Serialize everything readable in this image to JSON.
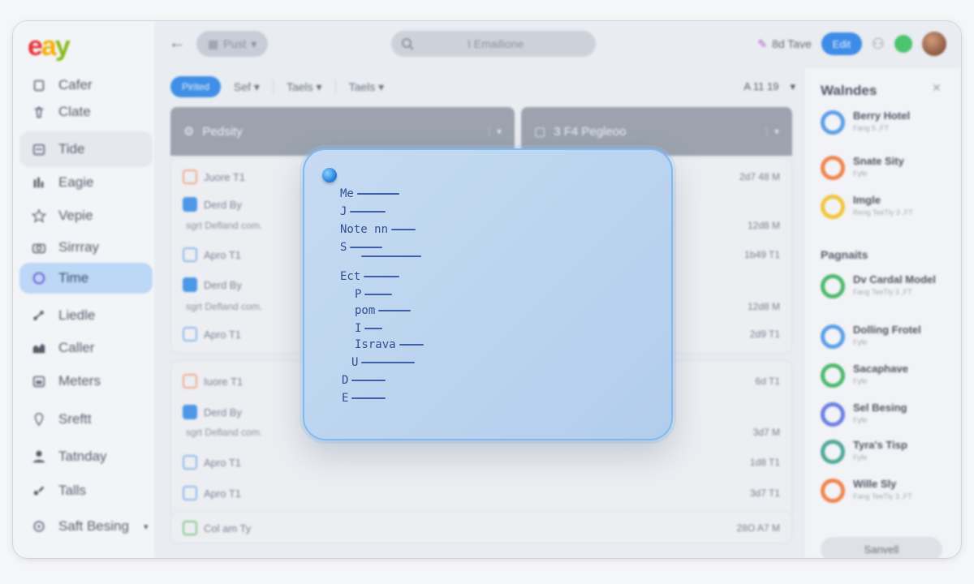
{
  "app": {
    "logo_parts": [
      "e",
      "a",
      "y"
    ]
  },
  "sidebar": {
    "items": [
      {
        "label": "Cafer",
        "icon": "home-icon"
      },
      {
        "label": "Clate",
        "icon": "trash-icon"
      },
      {
        "label": "Tide",
        "icon": "calendar-icon"
      },
      {
        "label": "Eagie",
        "icon": "chart-icon"
      },
      {
        "label": "Vepie",
        "icon": "star-icon"
      },
      {
        "label": "Sirrray",
        "icon": "camera-icon"
      },
      {
        "label": "Time",
        "icon": "clock-icon"
      },
      {
        "label": "Liedle",
        "icon": "share-icon"
      },
      {
        "label": "Caller",
        "icon": "bar-chart-icon"
      },
      {
        "label": "Meters",
        "icon": "calendar-grid-icon"
      },
      {
        "label": "Sreftt",
        "icon": "pin-icon"
      },
      {
        "label": "Tatnday",
        "icon": "user-icon"
      },
      {
        "label": "Talls",
        "icon": "tag-icon"
      },
      {
        "label": "Saft Besing",
        "icon": "settings-icon"
      }
    ]
  },
  "topbar": {
    "post_label": "Pust",
    "search_placeholder": "I Emailione",
    "right_label": "8d Tave",
    "edit_label": "Edit"
  },
  "filterbar": {
    "primary": "Pirited",
    "items": [
      "Sef",
      "Taels",
      "Taels"
    ],
    "right": "A 11 19"
  },
  "panels": [
    {
      "title": "Pedsity"
    },
    {
      "title": "3 F4 Pegleoo"
    }
  ],
  "list1": [
    {
      "label": "Juore T1",
      "value": "2d7 48 M"
    },
    {
      "label": "Derd By",
      "value": ""
    },
    {
      "label": "sgrt Defland com.",
      "value": "12d8 M"
    },
    {
      "label": "Apro T1",
      "value": "1b49 T1"
    },
    {
      "label": "Derd By",
      "value": ""
    },
    {
      "label": "sgrt Defland com.",
      "value": "12d8 M"
    },
    {
      "label": "Apro T1",
      "value": "2d9 T1"
    }
  ],
  "list2": [
    {
      "label": "Iuore T1",
      "value": "6d T1"
    },
    {
      "label": "Derd By",
      "value": ""
    },
    {
      "label": "sgrt Defland com.",
      "value": "3d7 M"
    },
    {
      "label": "Apro T1",
      "value": "1d8 T1"
    },
    {
      "label": "Apro T1",
      "value": "3d7 T1"
    }
  ],
  "list3": [
    {
      "label": "Col am Ty",
      "value": "28O A7 M"
    }
  ],
  "right_panel": {
    "title": "Walndes",
    "section1": [
      {
        "name": "Berry Hotel",
        "sub": "Fang 5 ,FT",
        "color": "#5a9ee8"
      },
      {
        "name": "Snate Sity",
        "sub": "Fyfe",
        "color": "#f0834d"
      },
      {
        "name": "Imgle",
        "sub": "Reng TeeTly 3 ,FT",
        "color": "#f2c53a"
      }
    ],
    "section2_title": "Pagnaits",
    "section2": [
      {
        "name": "Dv Cardal Model",
        "sub": "Fang TeeTly 3 ,FT",
        "color": "#4cb86a"
      },
      {
        "name": "Dolling Frotel",
        "sub": "Fyfe",
        "color": "#5a9ee8"
      },
      {
        "name": "Sacaphave",
        "sub": "Fyfe",
        "color": "#4cb86a"
      },
      {
        "name": "Sel Besing",
        "sub": "Fyfe",
        "color": "#6c7ee4"
      },
      {
        "name": "Tyra's Tisp",
        "sub": "Fyfe",
        "color": "#4fa89a"
      },
      {
        "name": "Wille Sly",
        "sub": "Fang TeeTly 3 ,FT",
        "color": "#f0834d"
      }
    ],
    "button_label": "Sanvell"
  },
  "note": {
    "lines": [
      "Me",
      "J",
      "Note nn",
      "S",
      "",
      "Ect",
      "P",
      "pom",
      "I",
      "Israva",
      "U",
      "D",
      "E"
    ]
  }
}
